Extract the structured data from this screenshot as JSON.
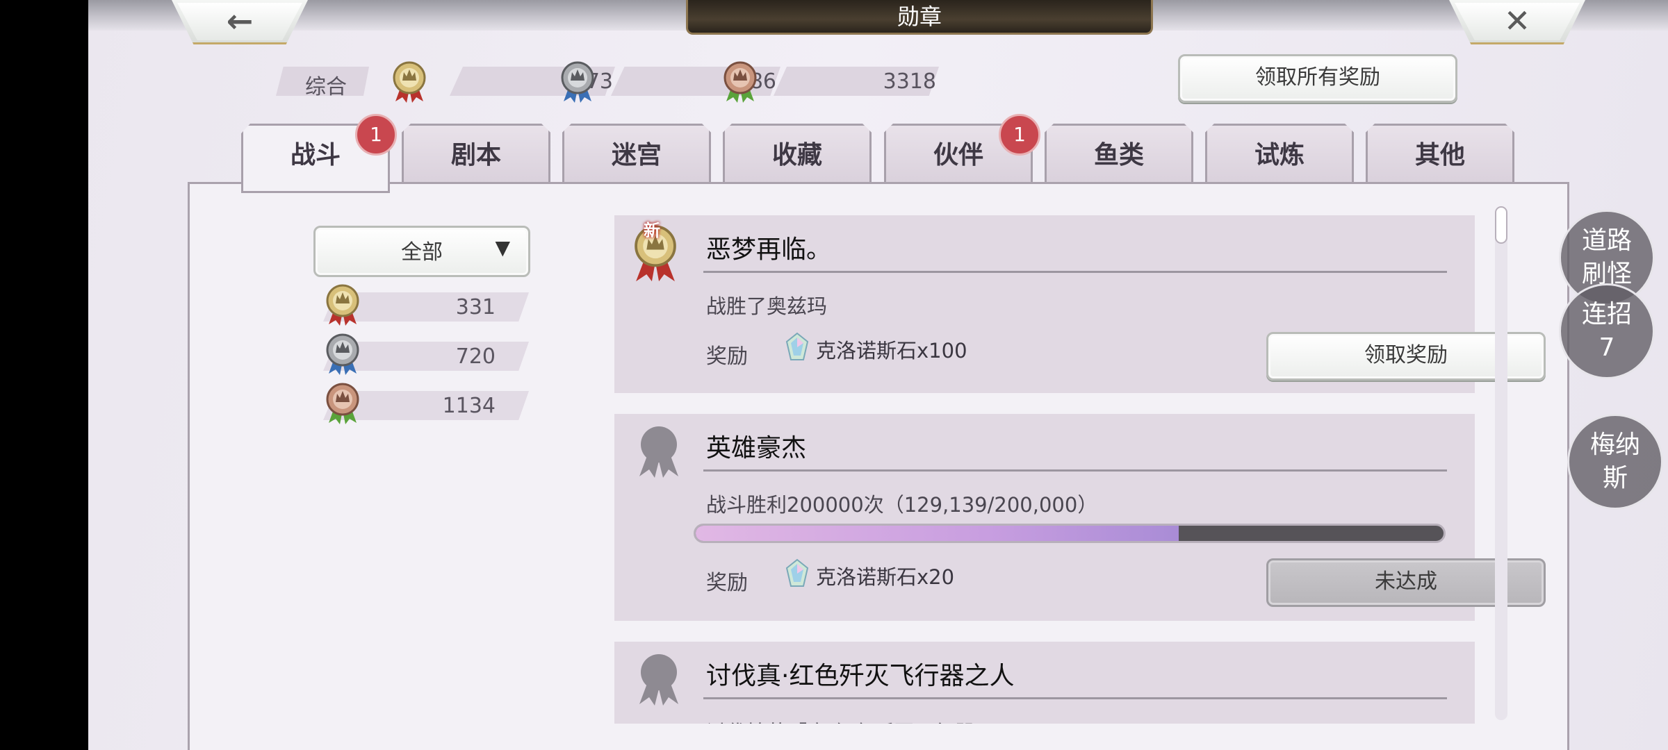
{
  "window": {
    "title": "勋章"
  },
  "nav": {
    "back_icon": "arrow-left-icon",
    "close_icon": "close-icon"
  },
  "summary": {
    "label": "综合",
    "gold": "473",
    "silver": "886",
    "bronze": "3318",
    "claim_all_label": "领取所有奖励"
  },
  "tabs": [
    {
      "label": "战斗",
      "badge": "1",
      "active": true
    },
    {
      "label": "剧本"
    },
    {
      "label": "迷宫"
    },
    {
      "label": "收藏"
    },
    {
      "label": "伙伴",
      "badge": "1"
    },
    {
      "label": "鱼类"
    },
    {
      "label": "试炼"
    },
    {
      "label": "其他"
    }
  ],
  "filter": {
    "selected": "全部",
    "counts": {
      "gold": "331",
      "silver": "720",
      "bronze": "1134"
    }
  },
  "cards": [
    {
      "new_tag": "新",
      "title": "恶梦再临。",
      "description": "战胜了奥兹玛",
      "reward_label": "奖励",
      "reward": "克洛诺斯石x100",
      "button": "领取奖励"
    },
    {
      "title": "英雄豪杰",
      "description": "战斗胜利200000次（129,139/200,000）",
      "progress": 0.646,
      "reward_label": "奖励",
      "reward": "克洛诺斯石x20",
      "button": "未达成"
    },
    {
      "title": "讨伐真·红色歼灭飞行器之人",
      "description": "讨伐精英「真·红色歼灭飞行器"
    }
  ],
  "floating": {
    "road_label": "道路刷怪",
    "combo_label": "连招7",
    "menas_label": "梅纳斯"
  },
  "colors": {
    "badge": "#c9474f",
    "gold_ribbon": "#b8322c",
    "silver_ribbon": "#3a6fb5",
    "bronze_ribbon": "#5aa33a"
  }
}
